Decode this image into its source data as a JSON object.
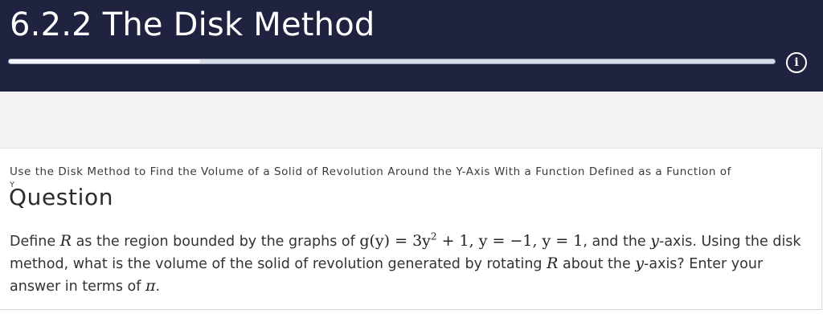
{
  "header": {
    "title": "6.2.2 The Disk Method",
    "progress_percent": 25,
    "info_icon": "info-icon",
    "colors": {
      "background": "#1f2340",
      "progress_fill": "#f4f5fa",
      "progress_track": "#d8dbe8"
    }
  },
  "card": {
    "subtitle": "Use the Disk Method to Find the Volume of a Solid of Revolution Around the Y-Axis With a Function Defined as a Function of",
    "subtitle_overflow": "Y",
    "question_heading": "Question",
    "question": {
      "p1": "Define ",
      "R1": "R",
      "p2": " as the region bounded by the graphs of ",
      "eq1": "g(y) = 3y",
      "exp": "2",
      "eq2": " + 1, y = −1, y = 1",
      "p3": ", and the ",
      "yv": "y",
      "p4": "-axis. Using the disk method, what is the volume of the solid of revolution generated by rotating ",
      "R2": "R",
      "p5": " about the ",
      "yv2": "y",
      "p6": "-axis? Enter your answer in terms of ",
      "pi": "π",
      "p7": "."
    }
  }
}
